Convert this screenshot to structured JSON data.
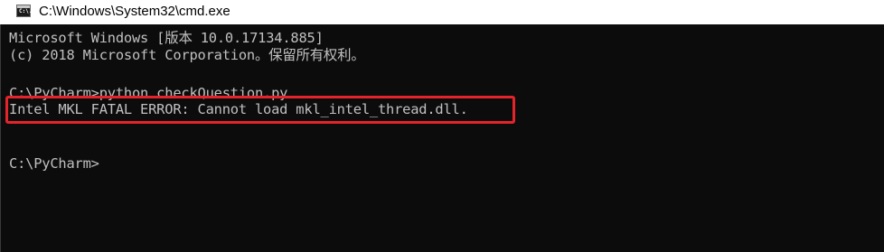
{
  "window": {
    "title": "C:\\Windows\\System32\\cmd.exe",
    "icon": "cmd-console-icon",
    "icon_label": "C:\\."
  },
  "console": {
    "lines": [
      "Microsoft Windows [版本 10.0.17134.885]",
      "(c) 2018 Microsoft Corporation。保留所有权利。",
      "C:\\PyCharm>python checkQuestion.py",
      "Intel MKL FATAL ERROR: Cannot load mkl_intel_thread.dll.",
      "C:\\PyCharm>"
    ],
    "background_color": "#0c0c0c",
    "text_color": "#c0c0c0",
    "highlight_color": "#e3242b"
  }
}
